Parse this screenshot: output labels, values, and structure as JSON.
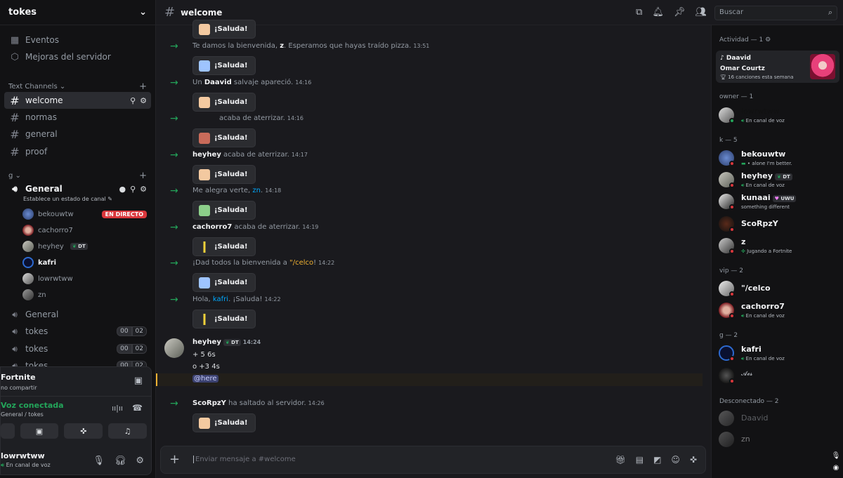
{
  "server": {
    "name": "tokes"
  },
  "sidebar": {
    "events": "Eventos",
    "boosts": "Mejoras del servidor",
    "cat_text": "Text Channels",
    "text_channels": [
      "welcome",
      "normas",
      "general",
      "proof"
    ],
    "cat_g": "g",
    "voice_general": "General",
    "voice_status": "Establece un estado de canal",
    "voice_users": [
      {
        "name": "bekouwtw",
        "badge": "EN DIRECTO"
      },
      {
        "name": "cachorro7"
      },
      {
        "name": "heyhey",
        "tag": "DT"
      },
      {
        "name": "kafri"
      },
      {
        "name": "lowrwtww"
      },
      {
        "name": "zn"
      }
    ],
    "voice_channels": [
      {
        "name": "General"
      },
      {
        "name": "tokes",
        "c1": "00",
        "c2": "02"
      },
      {
        "name": "tokes",
        "c1": "00",
        "c2": "02"
      },
      {
        "name": "tokes",
        "c1": "00",
        "c2": "02"
      }
    ]
  },
  "panel": {
    "stream_title": "Fortnite",
    "stream_sub": "no compartir",
    "voice_title": "Voz conectada",
    "voice_sub": "General / tokes",
    "me_name": "lowrwtww",
    "me_status": "En canal de voz"
  },
  "channel": {
    "name": "welcome"
  },
  "search": {
    "placeholder": "Buscar"
  },
  "wave_label": "¡Saluda!",
  "messages": [
    {
      "pre": "Te damos la bienvenida, ",
      "user": "z",
      "post": ". Esperamos que hayas traído pizza.",
      "time": "13:51"
    },
    {
      "pre": "Un ",
      "user": "Daavid",
      "post": " salvaje apareció.",
      "time": "14:16"
    },
    {
      "pre": "",
      "user": "",
      "post": "acaba de aterrizar.",
      "time": "14:16"
    },
    {
      "pre": "",
      "user": "heyhey",
      "post": " acaba de aterrizar.",
      "time": "14:17"
    },
    {
      "pre": "Me alegra verte, ",
      "user": "zn",
      "post": ".",
      "time": "14:18"
    },
    {
      "pre": "",
      "user": "cachorro7",
      "post": " acaba de aterrizar.",
      "time": "14:19"
    },
    {
      "pre": "¡Dad todos la bienvenida a ",
      "user": "\"/celco",
      "post": "!",
      "time": "14:22"
    },
    {
      "pre": "Hola, ",
      "user": "kafri",
      "post": ". ¡Saluda!",
      "time": "14:22"
    },
    {
      "pre": "",
      "user": "ScoRpzY",
      "post": " ha saltado al servidor.",
      "time": "14:26"
    }
  ],
  "user_msg": {
    "name": "heyhey",
    "tag": "DT",
    "time": "14:24",
    "line1": "+ 5 6s",
    "line2": "o +3 4s",
    "mention": "@here"
  },
  "composer": {
    "placeholder": "Enviar mensaje a #welcome"
  },
  "members": {
    "activity_cat": "Actividad — 1",
    "activity": {
      "user": "Daavid",
      "title": "Omar Courtz",
      "sub": "16 canciones esta semana"
    },
    "groups": [
      {
        "label": "owner — 1",
        "members": [
          {
            "name": "lowrwtww",
            "status": "En canal de voz"
          }
        ]
      },
      {
        "label": "k — 5",
        "members": [
          {
            "name": "bekouwtw",
            "status": "• alone I'm better."
          },
          {
            "name": "heyhey",
            "tag": "DT",
            "status": "En canal de voz"
          },
          {
            "name": "kunaai",
            "tag": "UWU",
            "status": "something different"
          },
          {
            "name": "ScoRpzY",
            "status": ""
          },
          {
            "name": "z",
            "status": "Jugando a Fortnite"
          }
        ]
      },
      {
        "label": "vip — 2",
        "members": [
          {
            "name": "\"/celco",
            "status": ""
          },
          {
            "name": "cachorro7",
            "status": "En canal de voz"
          }
        ]
      },
      {
        "label": "g — 2",
        "members": [
          {
            "name": "kafri",
            "status": "En canal de voz"
          },
          {
            "name": "𝓐𝓮𝓼",
            "status": ""
          }
        ]
      },
      {
        "label": "Desconectado — 2",
        "members": [
          {
            "name": "Daavid",
            "status": ""
          },
          {
            "name": "zn",
            "status": ""
          }
        ]
      }
    ]
  },
  "colors": {
    "online": "#23a55a",
    "dnd": "#da373c",
    "accent_orange": "#f0b232",
    "accent_blue": "#00a8fc"
  }
}
